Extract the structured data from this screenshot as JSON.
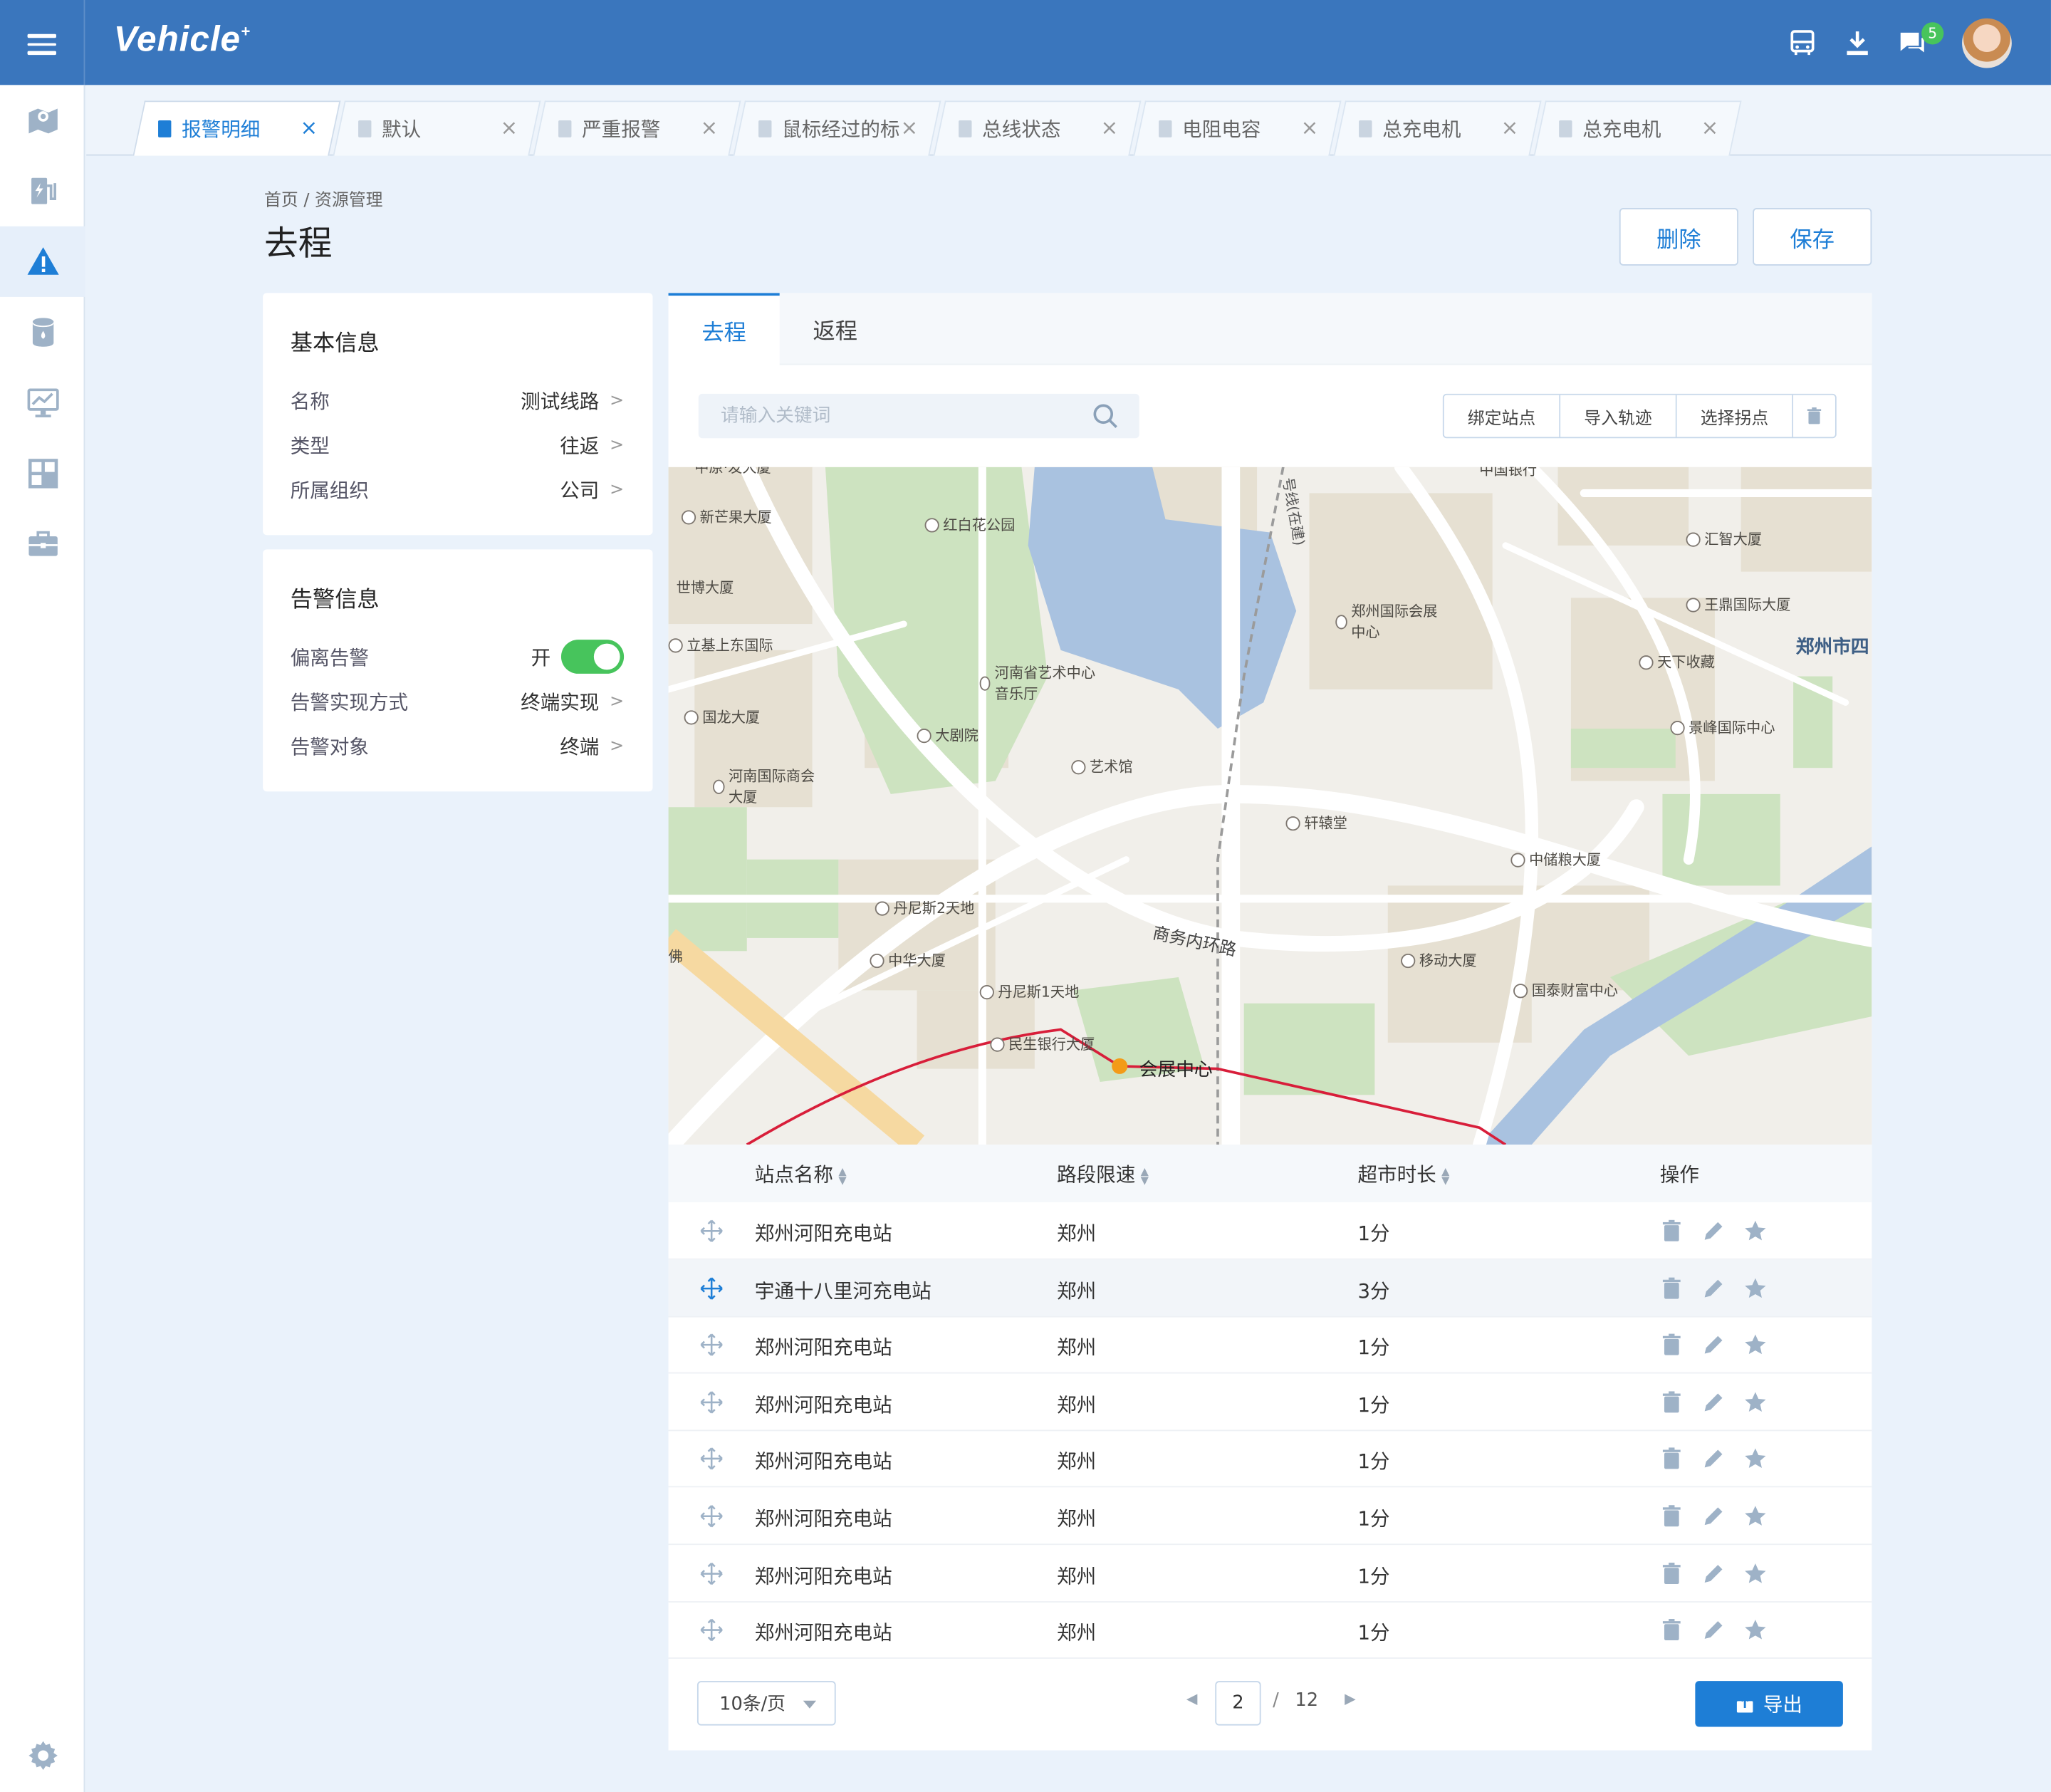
{
  "app": {
    "logo": "Vehicle",
    "logo_mark": "+",
    "message_badge": "5"
  },
  "icons": {
    "menu": "hamburger-menu-icon",
    "bus": "bus-icon",
    "download": "download-icon",
    "messages": "chat-icon",
    "sidebar": [
      "map-pin-icon",
      "charging-station-icon",
      "warning-icon",
      "database-icon",
      "monitor-chart-icon",
      "grid-icon",
      "briefcase-icon",
      "gear-icon"
    ]
  },
  "colors": {
    "brand": "#3a76bd",
    "accent": "#1e7ed6",
    "success": "#47c45c"
  },
  "tabs": [
    {
      "label": "报警明细",
      "active": true
    },
    {
      "label": "默认"
    },
    {
      "label": "严重报警"
    },
    {
      "label": "鼠标经过的标"
    },
    {
      "label": "总线状态"
    },
    {
      "label": "电阻电容"
    },
    {
      "label": "总充电机"
    },
    {
      "label": "总充电机"
    }
  ],
  "breadcrumb": "首页 / 资源管理",
  "page_title": "去程",
  "actions": {
    "delete": "删除",
    "save": "保存"
  },
  "basic_info": {
    "title": "基本信息",
    "rows": [
      {
        "label": "名称",
        "value": "测试线路"
      },
      {
        "label": "类型",
        "value": "往返"
      },
      {
        "label": "所属组织",
        "value": "公司"
      }
    ]
  },
  "alarm_info": {
    "title": "告警信息",
    "rows": [
      {
        "label": "偏离告警",
        "value": "开",
        "toggle": true
      },
      {
        "label": "告警实现方式",
        "value": "终端实现"
      },
      {
        "label": "告警对象",
        "value": "终端"
      }
    ]
  },
  "panel_tabs": [
    {
      "label": "去程",
      "active": true
    },
    {
      "label": "返程"
    }
  ],
  "search": {
    "placeholder": "请输入关键词",
    "value": ""
  },
  "toolbar": {
    "bind_station": "绑定站点",
    "import_track": "导入轨迹",
    "select_turn": "选择拐点",
    "delete_icon": "trash-icon"
  },
  "map_labels": [
    "中原·发大厦",
    "新芒果大厦",
    "红白花公园",
    "世博大厦",
    "立基上东国际",
    "国龙大厦",
    "河南国际商会大厦",
    "河南省艺术中心音乐厅",
    "大剧院",
    "艺术馆",
    "轩辕堂",
    "郑州国际会展中心",
    "汇智大厦",
    "王鼎国际大厦",
    "天下收藏",
    "郑州市四",
    "景峰国际中心",
    "中储粮大厦",
    "丹尼斯2天地",
    "中华大厦",
    "丹尼斯1天地",
    "民生银行大厦",
    "会展中心",
    "移动大厦",
    "国泰财富中心",
    "商务内环路",
    "号线(在建)",
    "佛",
    "中国银行"
  ],
  "table": {
    "headers": [
      "站点名称",
      "路段限速",
      "超市时长",
      "操作"
    ],
    "rows": [
      [
        "郑州河阳充电站",
        "郑州",
        "1分"
      ],
      [
        "宇通十八里河充电站",
        "郑州",
        "3分"
      ],
      [
        "郑州河阳充电站",
        "郑州",
        "1分"
      ],
      [
        "郑州河阳充电站",
        "郑州",
        "1分"
      ],
      [
        "郑州河阳充电站",
        "郑州",
        "1分"
      ],
      [
        "郑州河阳充电站",
        "郑州",
        "1分"
      ],
      [
        "郑州河阳充电站",
        "郑州",
        "1分"
      ],
      [
        "郑州河阳充电站",
        "郑州",
        "1分"
      ]
    ]
  },
  "pager": {
    "page_size": "10条/页",
    "current": "2",
    "separator": "/",
    "total": "12",
    "export": "导出"
  }
}
